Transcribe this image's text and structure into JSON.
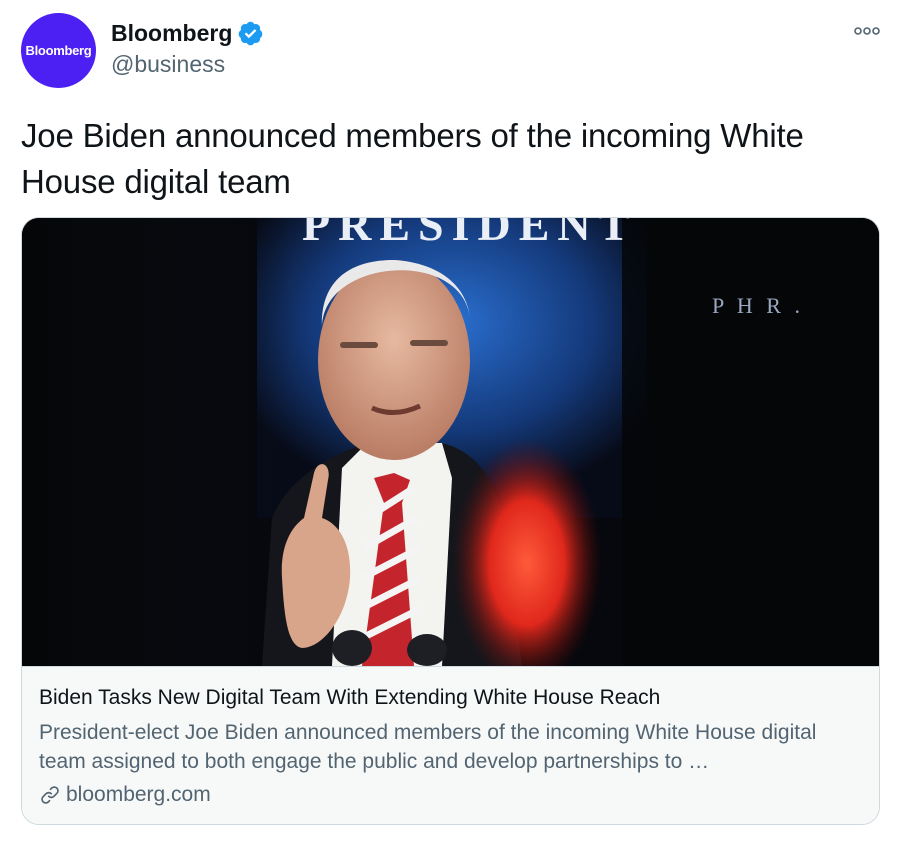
{
  "author": {
    "avatar_text": "Bloomberg",
    "display_name": "Bloomberg",
    "handle": "@business",
    "verified": true
  },
  "tweet": {
    "text": "Joe Biden announced members of the incoming White House digital team"
  },
  "card": {
    "image_sign_text": "PRESIDENT",
    "image_subtext": "P H R .",
    "title": "Biden Tasks New Digital Team With Extending White House Reach",
    "description": "President-elect Joe Biden announced members of the incoming White House digital team assigned to both engage the public and develop partnerships to …",
    "domain": "bloomberg.com"
  },
  "colors": {
    "avatar_bg": "#4c1ff2",
    "verified_blue": "#1d9bf0",
    "secondary_text": "#536471",
    "card_border": "#cfd9de",
    "card_body_bg": "#f7f9f9"
  },
  "icons": {
    "verified": "verified-badge-icon",
    "more": "more-options-icon",
    "link": "link-icon"
  }
}
